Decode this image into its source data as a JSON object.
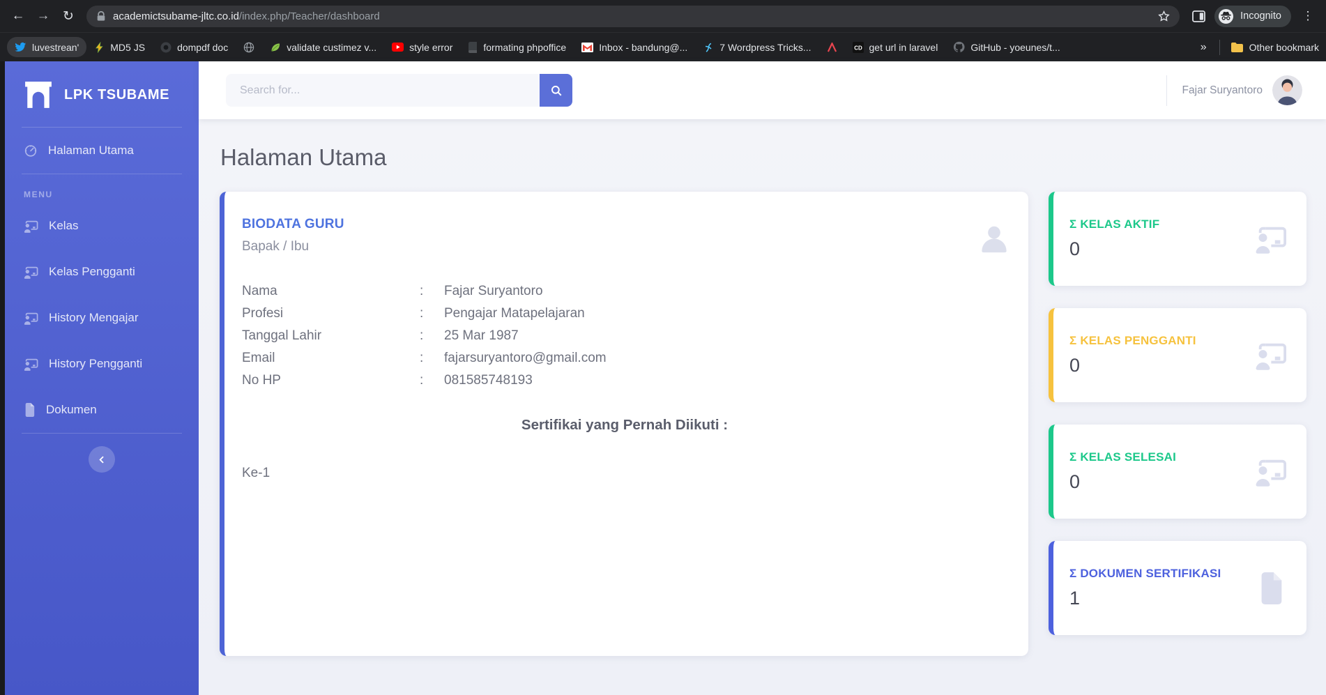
{
  "browser": {
    "url_domain": "academictsubame-jltc.co.id",
    "url_path": "/index.php/Teacher/dashboard",
    "incognito_label": "Incognito",
    "overflow_chevron": "»",
    "other_bookmarks_label": "Other bookmark",
    "bookmarks": [
      {
        "label": "luvestrean'",
        "icon": "twitter-icon",
        "active": true
      },
      {
        "label": "MD5 JS",
        "icon": "bolt-icon"
      },
      {
        "label": "dompdf doc",
        "icon": "dark-circle-icon"
      },
      {
        "label": "",
        "icon": "globe-icon"
      },
      {
        "label": "validate custimez v...",
        "icon": "leaf-icon"
      },
      {
        "label": "style error",
        "icon": "youtube-icon"
      },
      {
        "label": "formating phpoffice",
        "icon": "book-icon"
      },
      {
        "label": "Inbox - bandung@...",
        "icon": "gmail-icon"
      },
      {
        "label": "7 Wordpress Tricks...",
        "icon": "script-icon"
      },
      {
        "label": "",
        "icon": "red-a-icon"
      },
      {
        "label": "get url in laravel",
        "icon": "cd-icon"
      },
      {
        "label": "GitHub - yoeunes/t...",
        "icon": "github-icon"
      }
    ]
  },
  "sidebar": {
    "brand": "LPK TSUBAME",
    "home_label": "Halaman Utama",
    "menu_heading": "MENU",
    "items": [
      {
        "label": "Kelas",
        "icon": "chalkboard-teacher-icon"
      },
      {
        "label": "Kelas Pengganti",
        "icon": "chalkboard-teacher-icon"
      },
      {
        "label": "History Mengajar",
        "icon": "chalkboard-teacher-icon"
      },
      {
        "label": "History Pengganti",
        "icon": "chalkboard-teacher-icon"
      },
      {
        "label": "Dokumen",
        "icon": "file-icon"
      }
    ]
  },
  "topbar": {
    "search_placeholder": "Search for...",
    "user_name": "Fajar Suryantoro"
  },
  "page": {
    "title": "Halaman Utama"
  },
  "biodata": {
    "title": "BIODATA GURU",
    "subtitle": "Bapak / Ibu",
    "colon": ":",
    "fields": [
      {
        "label": "Nama",
        "value": "Fajar Suryantoro"
      },
      {
        "label": "Profesi",
        "value": "Pengajar Matapelajaran"
      },
      {
        "label": "Tanggal Lahir",
        "value": "25 Mar 1987"
      },
      {
        "label": "Email",
        "value": "fajarsuryantoro@gmail.com"
      },
      {
        "label": "No HP",
        "value": "081585748193"
      }
    ],
    "cert_heading": "Sertifikai yang Pernah Diikuti :",
    "cert_items": [
      "Ke-1"
    ]
  },
  "stats": [
    {
      "label": "Σ KELAS AKTIF",
      "value": "0",
      "color": "#1cc88a",
      "icon": "chalkboard-teacher-icon"
    },
    {
      "label": "Σ KELAS PENGGANTI",
      "value": "0",
      "color": "#f6c23e",
      "icon": "chalkboard-teacher-icon"
    },
    {
      "label": "Σ KELAS SELESAI",
      "value": "0",
      "color": "#1cc88a",
      "icon": "chalkboard-teacher-icon"
    },
    {
      "label": "Σ DOKUMEN SERTIFIKASI",
      "value": "1",
      "color": "#4d61de",
      "icon": "file-icon"
    }
  ],
  "colors": {
    "sidebar_top": "#5a6bd8",
    "sidebar_bottom": "#4757c8",
    "accent_blue": "#4e73df",
    "green": "#1cc88a",
    "yellow": "#f6c23e",
    "content_bg": "#f0f2f8"
  }
}
